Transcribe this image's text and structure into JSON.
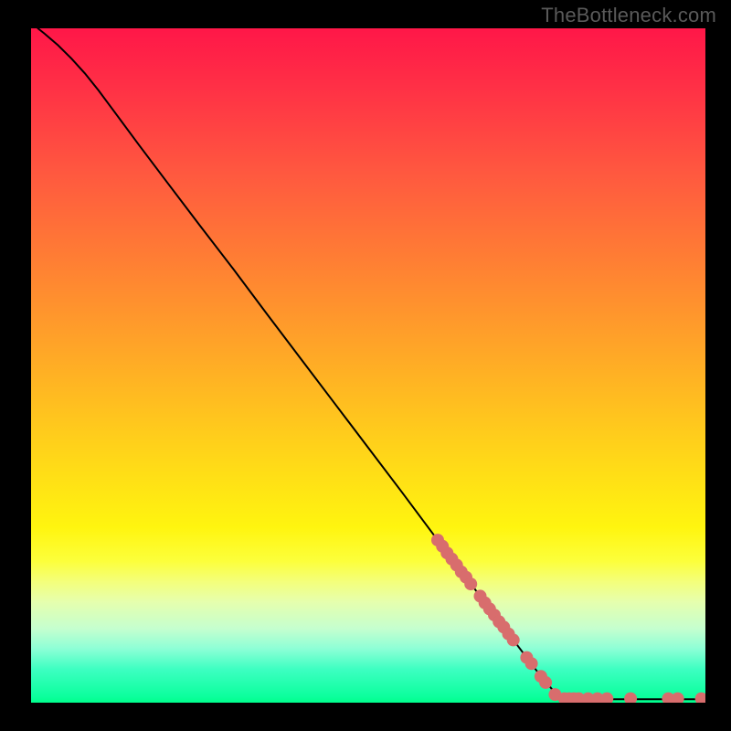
{
  "watermark": "TheBottleneck.com",
  "chart_data": {
    "type": "line",
    "title": "",
    "xlabel": "",
    "ylabel": "",
    "xlim": [
      0,
      100
    ],
    "ylim": [
      0,
      100
    ],
    "line": [
      {
        "x": 1.0,
        "y": 100.0
      },
      {
        "x": 2.0,
        "y": 99.2
      },
      {
        "x": 4.0,
        "y": 97.5
      },
      {
        "x": 6.0,
        "y": 95.5
      },
      {
        "x": 8.0,
        "y": 93.3
      },
      {
        "x": 10.0,
        "y": 90.8
      },
      {
        "x": 12.0,
        "y": 88.1
      },
      {
        "x": 16.0,
        "y": 82.7
      },
      {
        "x": 20.0,
        "y": 77.4
      },
      {
        "x": 25.0,
        "y": 70.8
      },
      {
        "x": 30.0,
        "y": 64.3
      },
      {
        "x": 35.0,
        "y": 57.6
      },
      {
        "x": 40.0,
        "y": 51.0
      },
      {
        "x": 45.0,
        "y": 44.4
      },
      {
        "x": 50.0,
        "y": 37.8
      },
      {
        "x": 55.0,
        "y": 31.2
      },
      {
        "x": 60.0,
        "y": 24.5
      },
      {
        "x": 65.0,
        "y": 17.9
      },
      {
        "x": 70.0,
        "y": 11.3
      },
      {
        "x": 75.0,
        "y": 4.7
      },
      {
        "x": 78.0,
        "y": 1.1
      },
      {
        "x": 79.0,
        "y": 0.6
      },
      {
        "x": 80.0,
        "y": 0.5
      },
      {
        "x": 85.0,
        "y": 0.5
      },
      {
        "x": 90.0,
        "y": 0.5
      },
      {
        "x": 95.0,
        "y": 0.5
      },
      {
        "x": 100.0,
        "y": 0.5
      }
    ],
    "points": [
      {
        "x": 60.3,
        "y": 24.1
      },
      {
        "x": 61.0,
        "y": 23.2
      },
      {
        "x": 61.7,
        "y": 22.2
      },
      {
        "x": 62.4,
        "y": 21.3
      },
      {
        "x": 63.1,
        "y": 20.4
      },
      {
        "x": 63.8,
        "y": 19.4
      },
      {
        "x": 64.5,
        "y": 18.6
      },
      {
        "x": 65.2,
        "y": 17.6
      },
      {
        "x": 66.6,
        "y": 15.8
      },
      {
        "x": 67.3,
        "y": 14.8
      },
      {
        "x": 68.0,
        "y": 13.9
      },
      {
        "x": 68.7,
        "y": 13.0
      },
      {
        "x": 69.4,
        "y": 12.0
      },
      {
        "x": 70.1,
        "y": 11.2
      },
      {
        "x": 70.8,
        "y": 10.2
      },
      {
        "x": 71.5,
        "y": 9.3
      },
      {
        "x": 73.5,
        "y": 6.7
      },
      {
        "x": 74.2,
        "y": 5.8
      },
      {
        "x": 75.6,
        "y": 3.9
      },
      {
        "x": 76.3,
        "y": 3.0
      },
      {
        "x": 77.7,
        "y": 1.2
      },
      {
        "x": 79.1,
        "y": 0.6
      },
      {
        "x": 79.8,
        "y": 0.6
      },
      {
        "x": 80.5,
        "y": 0.6
      },
      {
        "x": 81.2,
        "y": 0.6
      },
      {
        "x": 82.6,
        "y": 0.6
      },
      {
        "x": 84.0,
        "y": 0.6
      },
      {
        "x": 85.4,
        "y": 0.6
      },
      {
        "x": 88.9,
        "y": 0.6
      },
      {
        "x": 94.5,
        "y": 0.6
      },
      {
        "x": 95.9,
        "y": 0.6
      },
      {
        "x": 99.4,
        "y": 0.6
      }
    ],
    "point_color": "#d86d6d",
    "point_radius": 7
  }
}
